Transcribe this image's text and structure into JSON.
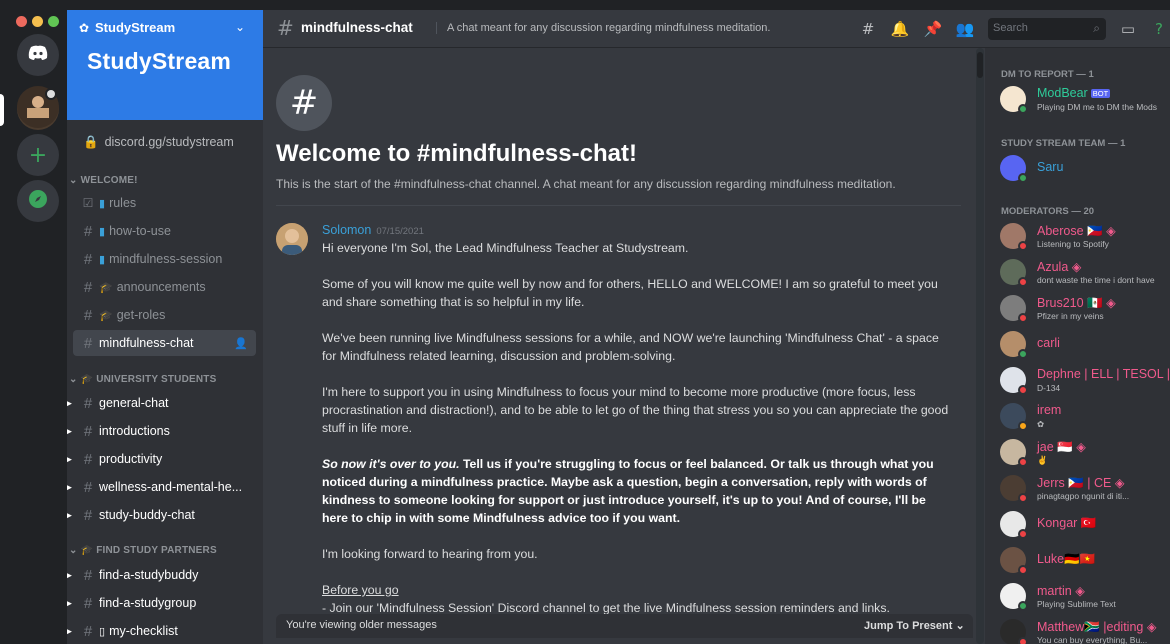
{
  "colors": {
    "accent": "#5865f2",
    "online": "#3ba55d",
    "dnd": "#ed4245",
    "idle": "#faa61a",
    "link": "#00aff4"
  },
  "server": {
    "name": "StudyStream",
    "banner_text": "StudyStream",
    "invite": "discord.gg/studystream"
  },
  "categories": {
    "welcome": "WELCOME!",
    "university": "UNIVERSITY STUDENTS",
    "partners": "FIND STUDY PARTNERS"
  },
  "channels": {
    "rules": "rules",
    "how_to_use": "how-to-use",
    "mindfulness_session": "mindfulness-session",
    "announcements": "announcements",
    "get_roles": "get-roles",
    "mindfulness_chat": "mindfulness-chat",
    "general_chat": "general-chat",
    "introductions": "introductions",
    "productivity": "productivity",
    "wellness": "wellness-and-mental-he...",
    "study_buddy_chat": "study-buddy-chat",
    "find_studybuddy": "find-a-studybuddy",
    "find_studygroup": "find-a-studygroup",
    "my_checklist": "my-checklist"
  },
  "header": {
    "channel": "mindfulness-chat",
    "topic": "A chat meant for any discussion regarding mindfulness meditation.",
    "search_placeholder": "Search"
  },
  "welcome": {
    "title": "Welcome to #mindfulness-chat!",
    "subtitle": "This is the start of the #mindfulness-chat channel. A chat meant for any discussion regarding mindfulness meditation."
  },
  "message": {
    "author": "Solomon",
    "timestamp": "07/15/2021",
    "p1": "Hi everyone I'm Sol, the Lead Mindfulness Teacher at Studystream.",
    "p2": "Some of you will know me quite well by now and for others, HELLO and WELCOME! I am so grateful to meet you and share something that is so helpful in my life.",
    "p3": "We've been running live Mindfulness sessions for a while, and NOW we're launching 'Mindfulness Chat' - a space for Mindfulness related learning, discussion and problem-solving.",
    "p4": "I'm here to support you in using Mindfulness to focus your mind to become more productive (more focus, less procrastination and distraction!), and to be able to let go of the thing that stress you so you can appreciate the good stuff in life more.",
    "p5_italic": "So now it's over to you.",
    "p5_rest": " Tell us if you're struggling to focus or feel balanced. Or talk us through what you noticed during a mindfulness practice. Maybe ask a question, begin a conversation, reply with words of kindness to someone looking for support or just introduce yourself, it's up to you! And of course, I'll be here to chip in with some Mindfulness advice too if you want.",
    "p6": "I'm looking forward to hearing from you.",
    "p7_heading": "Before you go",
    "p7_line": "- Join our 'Mindfulness Session' Discord channel to get the live Mindfulness session reminders and links."
  },
  "older_bar": {
    "left": "You're viewing older messages",
    "right": "Jump To Present"
  },
  "members": {
    "cat_dm": "DM TO REPORT — 1",
    "cat_team": "STUDY STREAM TEAM — 1",
    "cat_mods": "MODERATORS — 20",
    "list": [
      {
        "name": "ModBear",
        "badge": "BOT",
        "activity": "Playing DM me to DM the Mods",
        "color": "#2ecc9a"
      },
      {
        "name": "Saru",
        "activity": "",
        "color": "#3aa0d8"
      },
      {
        "name": "Aberose 🇵🇭 ◈",
        "activity": "Listening to Spotify",
        "color": "#f05a8c"
      },
      {
        "name": "Azula ◈",
        "activity": "dont waste the time i dont have",
        "color": "#f05a8c"
      },
      {
        "name": "Brus210 🇲🇽 ◈",
        "activity": "Pfizer in my veins",
        "color": "#f05a8c"
      },
      {
        "name": "carli",
        "activity": "",
        "color": "#f05a8c"
      },
      {
        "name": "Dephne | ELL | TESOL |...",
        "activity": "D-134",
        "color": "#f05a8c"
      },
      {
        "name": "irem",
        "activity": "",
        "color": "#f05a8c"
      },
      {
        "name": "jae 🇸🇬 ◈",
        "activity": "",
        "color": "#f05a8c"
      },
      {
        "name": "Jerrs 🇵🇭 | CE ◈",
        "activity": "pinagtagpo ngunit di iti...",
        "color": "#f05a8c"
      },
      {
        "name": "Kongar 🇹🇷",
        "activity": "",
        "color": "#f05a8c"
      },
      {
        "name": "Luke🇩🇪🇻🇳",
        "activity": "",
        "color": "#f05a8c"
      },
      {
        "name": "martin ◈",
        "activity": "Playing Sublime Text",
        "color": "#f05a8c"
      },
      {
        "name": "Matthew🇿🇦 |editing ◈",
        "activity": "You can buy everything, Bu...",
        "color": "#f05a8c"
      }
    ]
  }
}
